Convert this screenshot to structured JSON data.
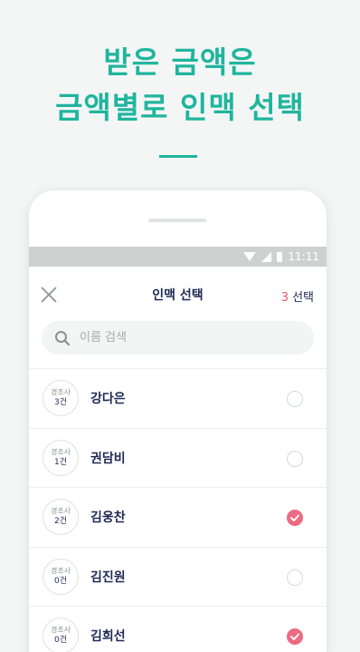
{
  "headline": {
    "line1": "받은 금액은",
    "line2": "금액별로 인맥 선택"
  },
  "statusbar": {
    "time": "11:11"
  },
  "appbar": {
    "title": "인맥 선택",
    "count": "3",
    "count_suffix": "선택"
  },
  "search": {
    "placeholder": "이름 검색",
    "value": ""
  },
  "contacts": [
    {
      "role": "경조사",
      "count": "3건",
      "name": "강다은",
      "selected": false
    },
    {
      "role": "경조사",
      "count": "1건",
      "name": "권담비",
      "selected": false
    },
    {
      "role": "경조사",
      "count": "2건",
      "name": "김웅찬",
      "selected": true
    },
    {
      "role": "경조사",
      "count": "0건",
      "name": "김진원",
      "selected": false
    },
    {
      "role": "경조사",
      "count": "0건",
      "name": "김희선",
      "selected": true
    }
  ],
  "colors": {
    "accent": "#1fb59d",
    "check": "#ee6a82",
    "text": "#1f2a55"
  },
  "icons": [
    "close-icon",
    "search-icon",
    "wifi-icon",
    "signal-icon",
    "battery-icon",
    "checkmark-icon"
  ]
}
